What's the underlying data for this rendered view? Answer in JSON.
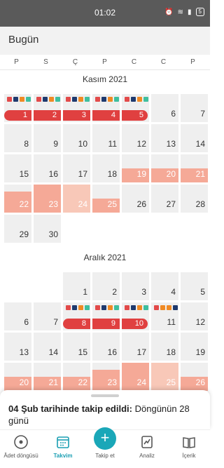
{
  "status_bar": {
    "time": "01:02",
    "battery": "5"
  },
  "header": {
    "title": "Bugün"
  },
  "weekdays": [
    "P",
    "S",
    "Ç",
    "P",
    "C",
    "C",
    "P"
  ],
  "november": {
    "label": "Kasım 2021",
    "days": [
      "1",
      "2",
      "3",
      "4",
      "5",
      "6",
      "7",
      "8",
      "9",
      "10",
      "11",
      "12",
      "13",
      "14",
      "15",
      "16",
      "17",
      "18",
      "19",
      "20",
      "21",
      "22",
      "23",
      "24",
      "25",
      "26",
      "27",
      "28",
      "29",
      "30"
    ]
  },
  "december": {
    "label": "Aralık 2021",
    "days": [
      "1",
      "2",
      "3",
      "4",
      "5",
      "6",
      "7",
      "8",
      "9",
      "10",
      "11",
      "12",
      "13",
      "14",
      "15",
      "16",
      "17",
      "18",
      "19",
      "20",
      "21",
      "22",
      "23",
      "24",
      "25",
      "26"
    ]
  },
  "symptom_colors": {
    "red": "#e24a4a",
    "navy": "#1f3a6e",
    "orange": "#f08a24",
    "teal": "#3fbf9e"
  },
  "colors": {
    "period": "#e04040",
    "fertile": "#f5a997",
    "accent": "#1aa7b8"
  },
  "bottom_sheet": {
    "bold": "04 Şub tarihinde takip edildi:",
    "normal": "Döngünün 28 günü"
  },
  "nav": {
    "cycle": "Âdet döngüsü",
    "calendar": "Takvim",
    "track": "Takip et",
    "analysis": "Analiz",
    "content": "İçerik"
  }
}
